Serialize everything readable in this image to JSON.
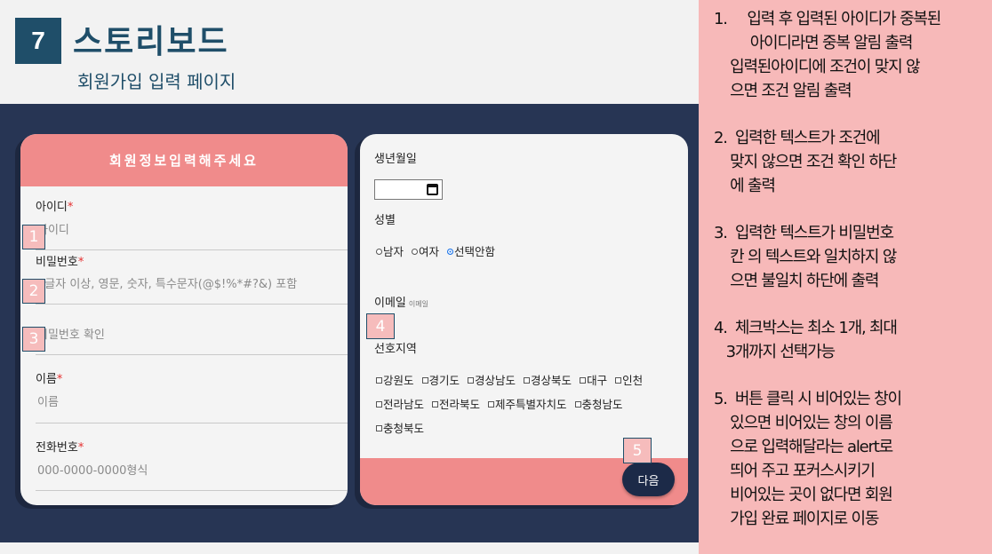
{
  "slide": {
    "number": "7",
    "title": "스토리보드",
    "subtitle": "회원가입 입력 페이지"
  },
  "left_form": {
    "header": "회원정보입력해주세요",
    "required_mark": "*",
    "fields": [
      {
        "label": "아이디",
        "placeholder": "아이디",
        "required": true
      },
      {
        "label": "비밀번호",
        "placeholder": "8글자 이상, 영문, 숫자, 특수문자(@$!%*#?&) 포함",
        "required": true
      },
      {
        "label": "",
        "placeholder": "비밀번호 확인",
        "required": false
      },
      {
        "label": "이름",
        "placeholder": "이름",
        "required": true
      },
      {
        "label": "전화번호",
        "placeholder": "000-0000-0000형식",
        "required": true
      }
    ]
  },
  "right_form": {
    "birth_label": "생년월일",
    "gender_label": "성별",
    "gender_options": [
      "남자",
      "여자",
      "선택안함"
    ],
    "gender_selected": "선택안함",
    "email_label": "이메일",
    "email_placeholder": "이메일",
    "region_label": "선호지역",
    "regions_row1": [
      "강원도",
      "경기도",
      "경상남도",
      "경상북도",
      "대구",
      "인천"
    ],
    "regions_row2": [
      "전라남도",
      "전라북도",
      "제주특별자치도",
      "충청남도"
    ],
    "regions_row3": [
      "충청북도"
    ],
    "next_button": "다음"
  },
  "markers": [
    "1",
    "2",
    "3",
    "4",
    "5"
  ],
  "notes": [
    "1.     입력 후 입력된 아이디가 중복된\n         아이디라면 중복 알림 출력\n    입력된아이디에 조건이 맞지 않\n    으면 조건 알림 출력",
    "2.  입력한 텍스트가 조건에\n    맞지 않으면 조건 확인 하단\n    에 출력",
    "3.  입력한 텍스트가 비밀번호\n    칸 의 텍스트와 일치하지 않\n    으면 불일치 하단에 출력",
    "4.  체크박스는 최소 1개, 최대\n   3개까지 선택가능",
    "5.  버튼 클릭 시 비어있는 창이\n    있으면 비어있는 창의 이름\n    으로 입력해달라는 alert로\n    띄어 주고 포커스시키기\n    비어있는 곳이 없다면 회원\n    가입 완료 페이지로 이동"
  ]
}
